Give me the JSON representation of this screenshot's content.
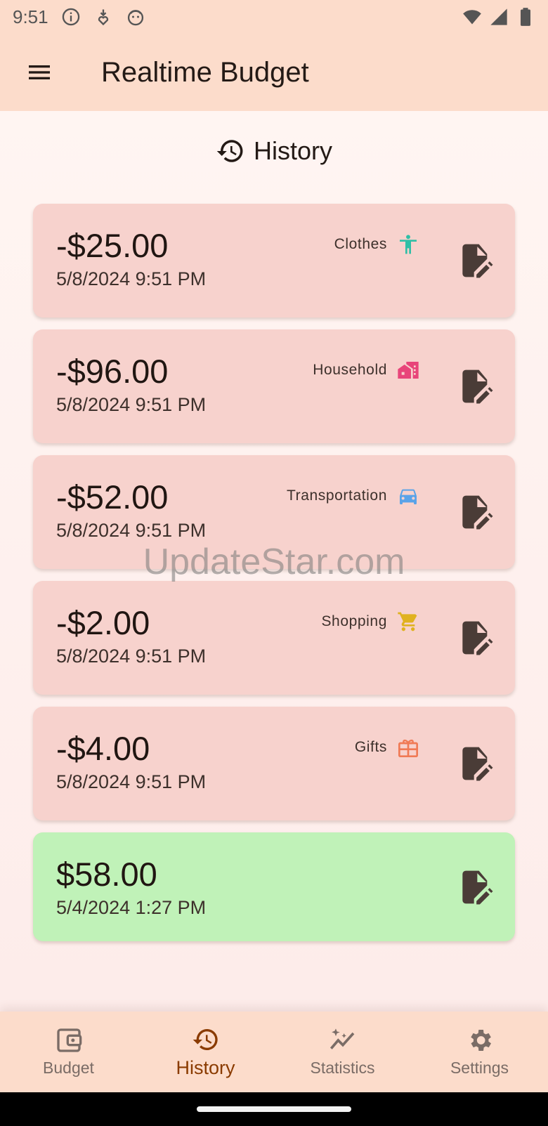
{
  "status_bar": {
    "time": "9:51",
    "icons": [
      "info-icon",
      "download-heart-icon",
      "face-icon"
    ],
    "right_icons": [
      "wifi-icon",
      "signal-icon",
      "battery-icon"
    ]
  },
  "app_bar": {
    "title": "Realtime Budget",
    "menu_icon": "menu-icon"
  },
  "section": {
    "title": "History",
    "icon": "history-icon"
  },
  "transactions": [
    {
      "amount": "-$25.00",
      "date": "5/8/2024 9:51 PM",
      "category": "Clothes",
      "category_icon": "person-icon",
      "category_color": "#2fbfa6",
      "type": "expense"
    },
    {
      "amount": "-$96.00",
      "date": "5/8/2024 9:51 PM",
      "category": "Household",
      "category_icon": "house-icon",
      "category_color": "#e8457a",
      "type": "expense"
    },
    {
      "amount": "-$52.00",
      "date": "5/8/2024 9:51 PM",
      "category": "Transportation",
      "category_icon": "car-icon",
      "category_color": "#5aa3e8",
      "type": "expense"
    },
    {
      "amount": "-$2.00",
      "date": "5/8/2024 9:51 PM",
      "category": "Shopping",
      "category_icon": "cart-icon",
      "category_color": "#e0b21f",
      "type": "expense"
    },
    {
      "amount": "-$4.00",
      "date": "5/8/2024 9:51 PM",
      "category": "Gifts",
      "category_icon": "gift-icon",
      "category_color": "#f07a55",
      "type": "expense"
    },
    {
      "amount": "$58.00",
      "date": "5/4/2024 1:27 PM",
      "category": "",
      "category_icon": "",
      "category_color": "",
      "type": "income"
    }
  ],
  "watermark": "UpdateStar.com",
  "bottom_nav": [
    {
      "label": "Budget",
      "icon": "wallet-icon",
      "active": false
    },
    {
      "label": "History",
      "icon": "history-icon",
      "active": true
    },
    {
      "label": "Statistics",
      "icon": "sparkle-chart-icon",
      "active": false
    },
    {
      "label": "Settings",
      "icon": "gear-icon",
      "active": false
    }
  ],
  "colors": {
    "app_bar": "#fcdccb",
    "expense_card": "#f7d2cd",
    "income_card": "#c0f2b8",
    "active_nav": "#8a3b00",
    "edit_icon": "#4a3c37"
  }
}
